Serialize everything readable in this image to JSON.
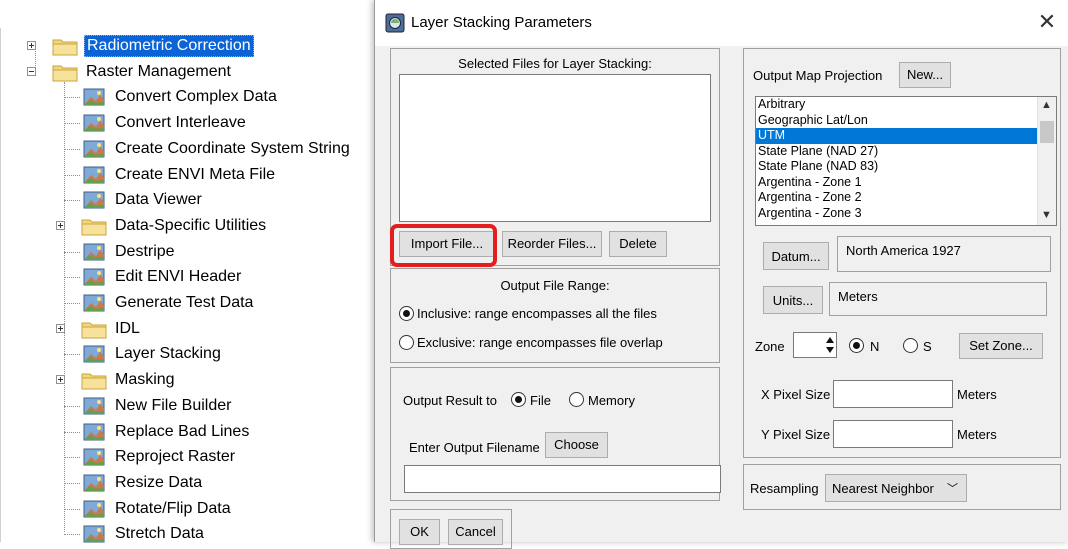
{
  "tree": {
    "items": [
      {
        "label": "Radiometric Correction",
        "kind": "folder",
        "expandable": true,
        "selected": true
      },
      {
        "label": "Raster Management",
        "kind": "folder",
        "expandable": true,
        "expanded": true
      },
      {
        "label": "Convert Complex Data",
        "kind": "tool"
      },
      {
        "label": "Convert Interleave",
        "kind": "tool"
      },
      {
        "label": "Create Coordinate System String",
        "kind": "tool"
      },
      {
        "label": "Create ENVI Meta File",
        "kind": "tool"
      },
      {
        "label": "Data Viewer",
        "kind": "tool"
      },
      {
        "label": "Data-Specific Utilities",
        "kind": "folder",
        "expandable": true
      },
      {
        "label": "Destripe",
        "kind": "tool"
      },
      {
        "label": "Edit ENVI Header",
        "kind": "tool"
      },
      {
        "label": "Generate Test Data",
        "kind": "tool"
      },
      {
        "label": "IDL",
        "kind": "folder",
        "expandable": true
      },
      {
        "label": "Layer Stacking",
        "kind": "tool"
      },
      {
        "label": "Masking",
        "kind": "folder",
        "expandable": true
      },
      {
        "label": "New File Builder",
        "kind": "tool"
      },
      {
        "label": "Replace Bad Lines",
        "kind": "tool"
      },
      {
        "label": "Reproject Raster",
        "kind": "tool"
      },
      {
        "label": "Resize Data",
        "kind": "tool"
      },
      {
        "label": "Rotate/Flip Data",
        "kind": "tool"
      },
      {
        "label": "Stretch Data",
        "kind": "tool"
      }
    ]
  },
  "dialog": {
    "title": "Layer Stacking Parameters",
    "selected_files": {
      "label": "Selected Files for Layer Stacking:",
      "files": [],
      "import_button": "Import File...",
      "reorder_button": "Reorder Files...",
      "delete_button": "Delete"
    },
    "output_range": {
      "label": "Output File Range:",
      "inclusive_label": "Inclusive: range encompasses all the files",
      "exclusive_label": "Exclusive: range encompasses file overlap",
      "selected": "inclusive"
    },
    "output": {
      "result_label": "Output Result to",
      "file_label": "File",
      "memory_label": "Memory",
      "selected": "file",
      "filename_label": "Enter Output Filename",
      "choose_button": "Choose",
      "filename_value": ""
    },
    "projection": {
      "label": "Output Map Projection",
      "new_button": "New...",
      "options": [
        "Arbitrary",
        "Geographic Lat/Lon",
        "UTM",
        "State Plane (NAD 27)",
        "State Plane (NAD 83)",
        "Argentina - Zone 1",
        "Argentina - Zone 2",
        "Argentina - Zone 3"
      ],
      "selected": "UTM"
    },
    "datum": {
      "button": "Datum...",
      "value": "North America 1927"
    },
    "units": {
      "button": "Units...",
      "value": "Meters"
    },
    "zone": {
      "label": "Zone",
      "value": "",
      "n_label": "N",
      "s_label": "S",
      "hemisphere": "N",
      "set_button": "Set Zone..."
    },
    "x_pixel": {
      "label": "X Pixel Size",
      "value": "",
      "unit": "Meters"
    },
    "y_pixel": {
      "label": "Y Pixel Size",
      "value": "",
      "unit": "Meters"
    },
    "resampling": {
      "label": "Resampling",
      "value": "Nearest Neighbor"
    },
    "ok_button": "OK",
    "cancel_button": "Cancel",
    "close_icon": "close-icon",
    "accent_color": "#0078d7",
    "highlight_color": "#e41e1e"
  }
}
